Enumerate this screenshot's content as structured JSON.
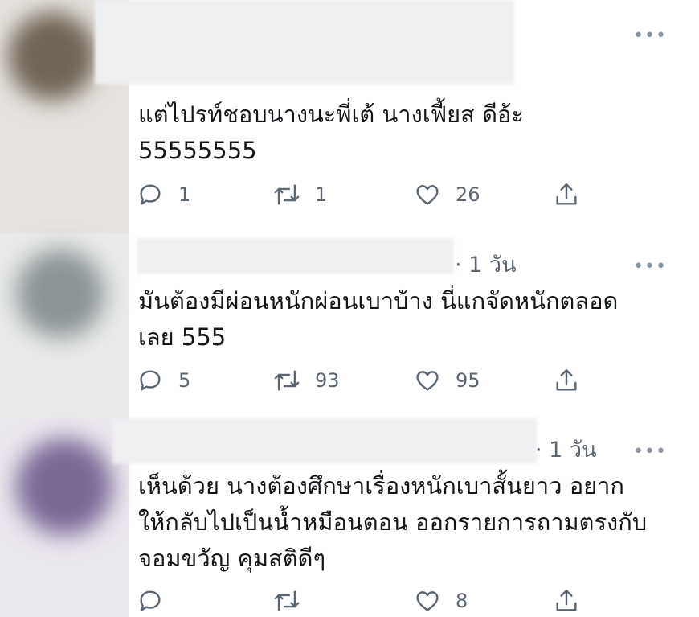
{
  "replies": [
    {
      "time": "",
      "text": "แต่ไปรท์ชอบนางนะพี่เต้ นางเฟี้ยส ดีอ้ะ\n55555555",
      "reply_count": "1",
      "retweet_count": "1",
      "like_count": "26",
      "more_label": "•••"
    },
    {
      "time": "· 1 วัน",
      "text": "มันต้องมีผ่อนหนักผ่อนเบาบ้าง นี่แกจัดหนักตลอด\nเลย 555",
      "reply_count": "5",
      "retweet_count": "93",
      "like_count": "95",
      "more_label": "•••"
    },
    {
      "time": "· 1 วัน",
      "text": "เห็นด้วย นางต้องศึกษาเรื่องหนักเบาสั้นยาว อยาก\nให้กลับไปเป็นน้ำหมือนตอน ออกรายการถามตรงกับ\nจอมขวัญ คุมสติดีๆ",
      "reply_count": "",
      "retweet_count": "",
      "like_count": "8",
      "more_label": "•••"
    }
  ],
  "icons": {
    "reply": "reply-icon",
    "retweet": "retweet-icon",
    "like": "heart-icon",
    "share": "share-icon"
  },
  "colors": {
    "text": "#14171a",
    "secondary": "#5b6672",
    "icon": "#5b6672"
  }
}
